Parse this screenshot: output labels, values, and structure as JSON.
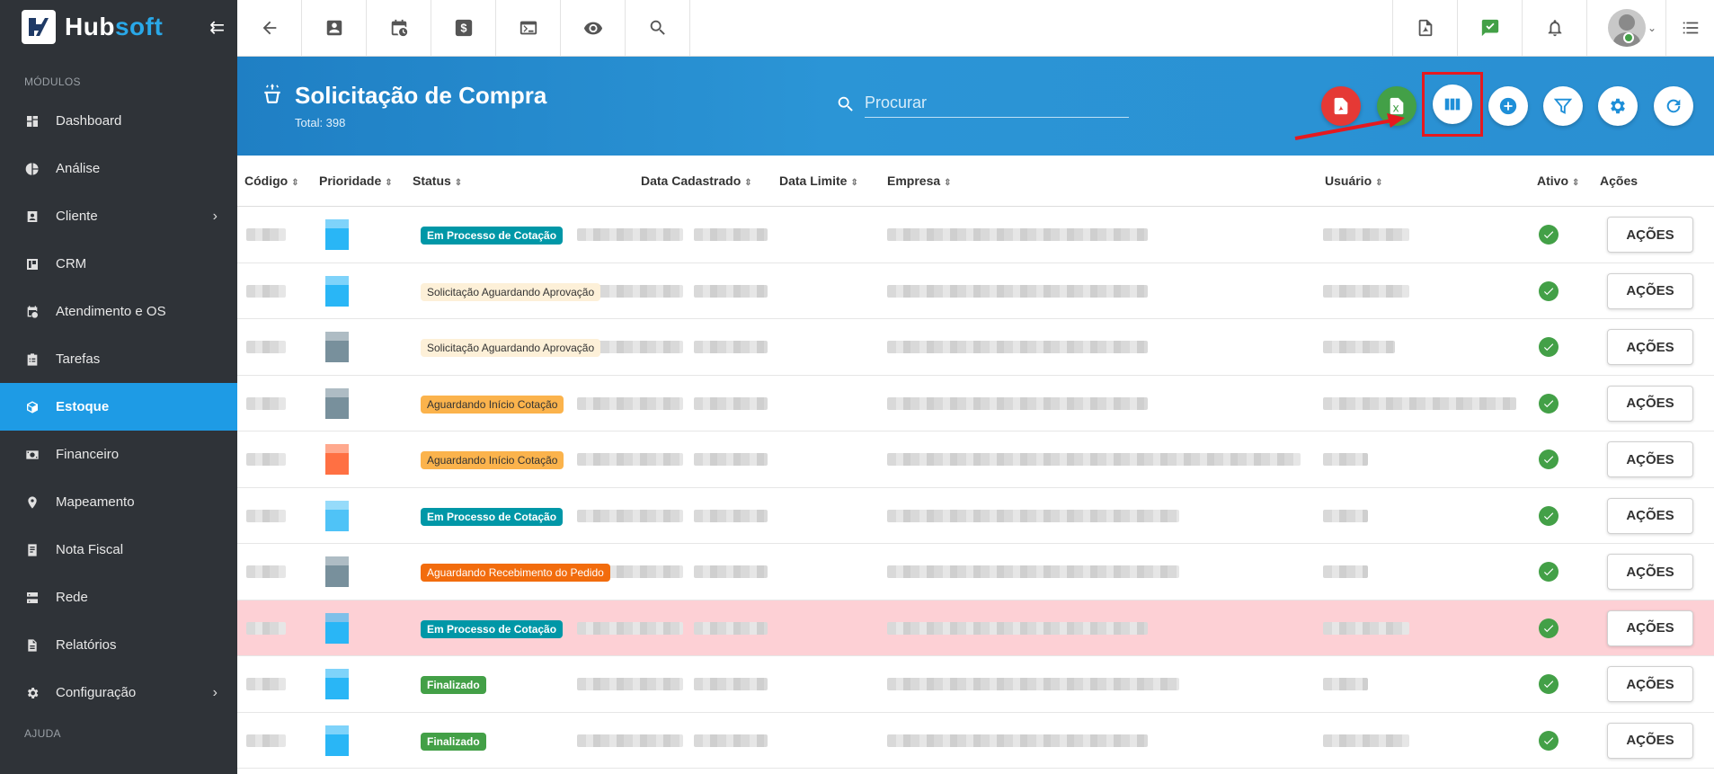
{
  "app": {
    "logo_hub": "Hub",
    "logo_soft": "soft"
  },
  "sidebar": {
    "section_modules": "MÓDULOS",
    "section_help": "AJUDA",
    "items": [
      {
        "label": "Dashboard",
        "icon": "dashboard-icon"
      },
      {
        "label": "Análise",
        "icon": "pie-chart-icon"
      },
      {
        "label": "Cliente",
        "icon": "contact-card-icon",
        "has_children": true
      },
      {
        "label": "CRM",
        "icon": "crm-icon"
      },
      {
        "label": "Atendimento e OS",
        "icon": "calendar-clock-icon"
      },
      {
        "label": "Tarefas",
        "icon": "tasks-icon"
      },
      {
        "label": "Estoque",
        "icon": "box-icon",
        "active": true
      },
      {
        "label": "Financeiro",
        "icon": "money-icon"
      },
      {
        "label": "Mapeamento",
        "icon": "map-pin-icon"
      },
      {
        "label": "Nota Fiscal",
        "icon": "invoice-icon"
      },
      {
        "label": "Rede",
        "icon": "network-icon"
      },
      {
        "label": "Relatórios",
        "icon": "report-icon"
      },
      {
        "label": "Configuração",
        "icon": "gear-icon",
        "has_children": true
      }
    ]
  },
  "page": {
    "title": "Solicitação de Compra",
    "total": "Total: 398",
    "search_placeholder": "Procurar"
  },
  "colors": {
    "accent": "#1e9be5",
    "pdf_button": "#e53935",
    "excel_button": "#43a047",
    "highlight": "#e5191f"
  },
  "table": {
    "headers": [
      "Código",
      "Prioridade",
      "Status",
      "Data Cadastrado",
      "Data Limite",
      "Empresa",
      "Usuário",
      "Ativo",
      "Ações"
    ],
    "action_label": "AÇÕES",
    "rows": [
      {
        "status": "Em Processo de Cotação",
        "style": "teal",
        "priority_color": "#29b6f6"
      },
      {
        "status": "Solicitação Aguardando Aprovação",
        "style": "cream",
        "priority_color": "#29b6f6"
      },
      {
        "status": "Solicitação Aguardando Aprovação",
        "style": "cream",
        "priority_color": "#78909c"
      },
      {
        "status": "Aguardando Início Cotação",
        "style": "orange",
        "priority_color": "#78909c"
      },
      {
        "status": "Aguardando Início Cotação",
        "style": "orange",
        "priority_color": "#ff7043"
      },
      {
        "status": "Em Processo de Cotação",
        "style": "teal",
        "priority_color": "#4fc3f7"
      },
      {
        "status": "Aguardando Recebimento do Pedido",
        "style": "deep",
        "priority_color": "#78909c"
      },
      {
        "status": "Em Processo de Cotação",
        "style": "teal",
        "priority_color": "#29b6f6",
        "highlighted": true
      },
      {
        "status": "Finalizado",
        "style": "green",
        "priority_color": "#29b6f6"
      },
      {
        "status": "Finalizado",
        "style": "green",
        "priority_color": "#29b6f6"
      }
    ]
  }
}
